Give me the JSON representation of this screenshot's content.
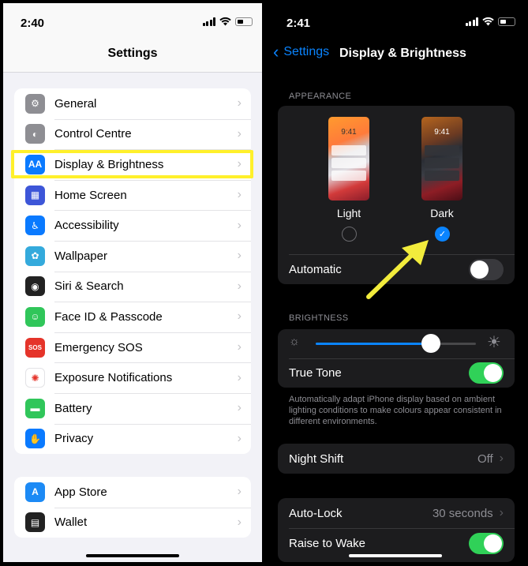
{
  "left": {
    "status": {
      "time": "2:40"
    },
    "title": "Settings",
    "group1": [
      {
        "label": "General",
        "icon": "gear-icon",
        "color": "#8e8e93",
        "glyph": "⚙"
      },
      {
        "label": "Control Centre",
        "icon": "toggles-icon",
        "color": "#8e8e93",
        "glyph": "◐"
      },
      {
        "label": "Display & Brightness",
        "icon": "text-size-icon",
        "color": "#0a7aff",
        "glyph": "AA"
      },
      {
        "label": "Home Screen",
        "icon": "app-grid-icon",
        "color": "#3d56d8",
        "glyph": "▦"
      },
      {
        "label": "Accessibility",
        "icon": "accessibility-icon",
        "color": "#0a7aff",
        "glyph": "♿"
      },
      {
        "label": "Wallpaper",
        "icon": "flower-icon",
        "color": "#34aadc",
        "glyph": "✿"
      },
      {
        "label": "Siri & Search",
        "icon": "siri-icon",
        "color": "#222",
        "glyph": "◉"
      },
      {
        "label": "Face ID & Passcode",
        "icon": "face-id-icon",
        "color": "#30c65a",
        "glyph": "☺"
      },
      {
        "label": "Emergency SOS",
        "icon": "sos-icon",
        "color": "#e5342a",
        "glyph": "SOS"
      },
      {
        "label": "Exposure Notifications",
        "icon": "exposure-icon",
        "color": "#ffffff",
        "glyph": "✺"
      },
      {
        "label": "Battery",
        "icon": "battery-icon",
        "color": "#30c65a",
        "glyph": "▬"
      },
      {
        "label": "Privacy",
        "icon": "hand-icon",
        "color": "#0a7aff",
        "glyph": "✋"
      }
    ],
    "group2": [
      {
        "label": "App Store",
        "icon": "app-store-icon",
        "color": "#1c8af5",
        "glyph": "A"
      },
      {
        "label": "Wallet",
        "icon": "wallet-icon",
        "color": "#222",
        "glyph": "▤"
      }
    ],
    "chevron": "›"
  },
  "right": {
    "status": {
      "time": "2:41"
    },
    "back_label": "Settings",
    "title": "Display & Brightness",
    "appearance_header": "APPEARANCE",
    "light_label": "Light",
    "dark_label": "Dark",
    "preview_time": "9:41",
    "automatic_label": "Automatic",
    "automatic_on": false,
    "brightness_header": "BRIGHTNESS",
    "brightness_level": 0.72,
    "true_tone_label": "True Tone",
    "true_tone_on": true,
    "true_tone_note": "Automatically adapt iPhone display based on ambient lighting conditions to make colours appear consistent in different environments.",
    "night_shift_label": "Night Shift",
    "night_shift_value": "Off",
    "auto_lock_label": "Auto-Lock",
    "auto_lock_value": "30 seconds",
    "raise_to_wake_label": "Raise to Wake",
    "raise_to_wake_on": true,
    "selected_appearance": "Dark",
    "check_glyph": "✓",
    "chevron": "›"
  },
  "colors": {
    "accent": "#0a84ff",
    "highlight": "#fff02a",
    "toggle_on": "#30d158",
    "annotation_arrow": "#f2ec3c"
  }
}
